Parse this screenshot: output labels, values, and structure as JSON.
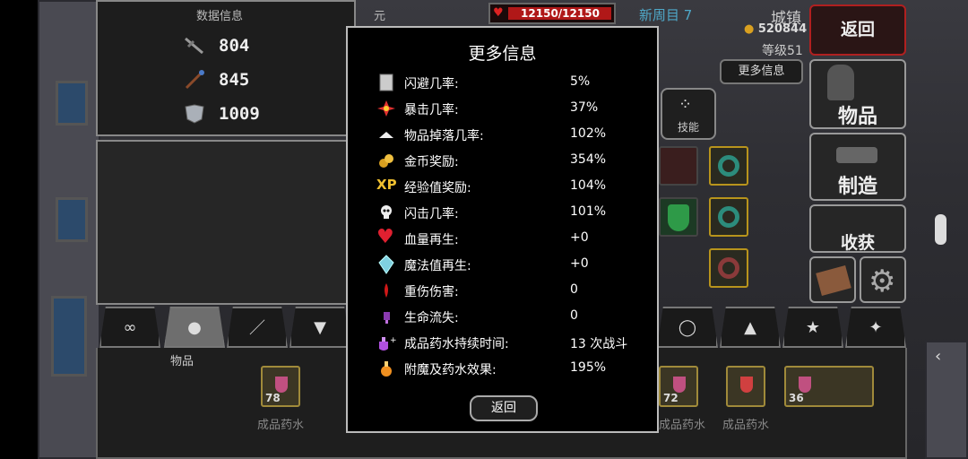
{
  "stats": {
    "head_left": "数据信息",
    "head_right": "元素",
    "attack": "804",
    "magic": "845",
    "defense": "1009"
  },
  "top": {
    "hp": "12150/12150",
    "new_round": "新周目 7",
    "town": "城镇",
    "gold": "520844",
    "level": "等级51",
    "more_info_label": "更多信息"
  },
  "side": {
    "back": "返回",
    "items": "物品",
    "craft": "制造",
    "harvest": "收获"
  },
  "skills_label": "技能",
  "tabs": {
    "active_label": "物品"
  },
  "inventory": {
    "potion_label": "成品药水",
    "counts": [
      "78",
      "72",
      "36"
    ]
  },
  "modal": {
    "title": "更多信息",
    "rows": [
      {
        "label": "闪避几率:",
        "value": "5%",
        "icon": "shield-icon"
      },
      {
        "label": "暴击几率:",
        "value": "37%",
        "icon": "crit-star-icon"
      },
      {
        "label": "物品掉落几率:",
        "value": "102%",
        "icon": "item-drop-icon"
      },
      {
        "label": "金币奖励:",
        "value": "354%",
        "icon": "gold-coin-icon"
      },
      {
        "label": "经验值奖励:",
        "value": "104%",
        "icon": "xp-icon"
      },
      {
        "label": "闪击几率:",
        "value": "101%",
        "icon": "skull-icon"
      },
      {
        "label": "血量再生:",
        "value": "+0",
        "icon": "heart-plus-icon"
      },
      {
        "label": "魔法值再生:",
        "value": "+0",
        "icon": "mana-crystal-icon"
      },
      {
        "label": "重伤伤害:",
        "value": "0",
        "icon": "blood-drop-icon"
      },
      {
        "label": "生命流失:",
        "value": "0",
        "icon": "purple-drain-icon"
      },
      {
        "label": "成品药水持续时间:",
        "value": "13 次战斗",
        "icon": "potion-duration-icon"
      },
      {
        "label": "附魔及药水效果:",
        "value": "195%",
        "icon": "orange-potion-icon"
      }
    ],
    "back": "返回"
  }
}
